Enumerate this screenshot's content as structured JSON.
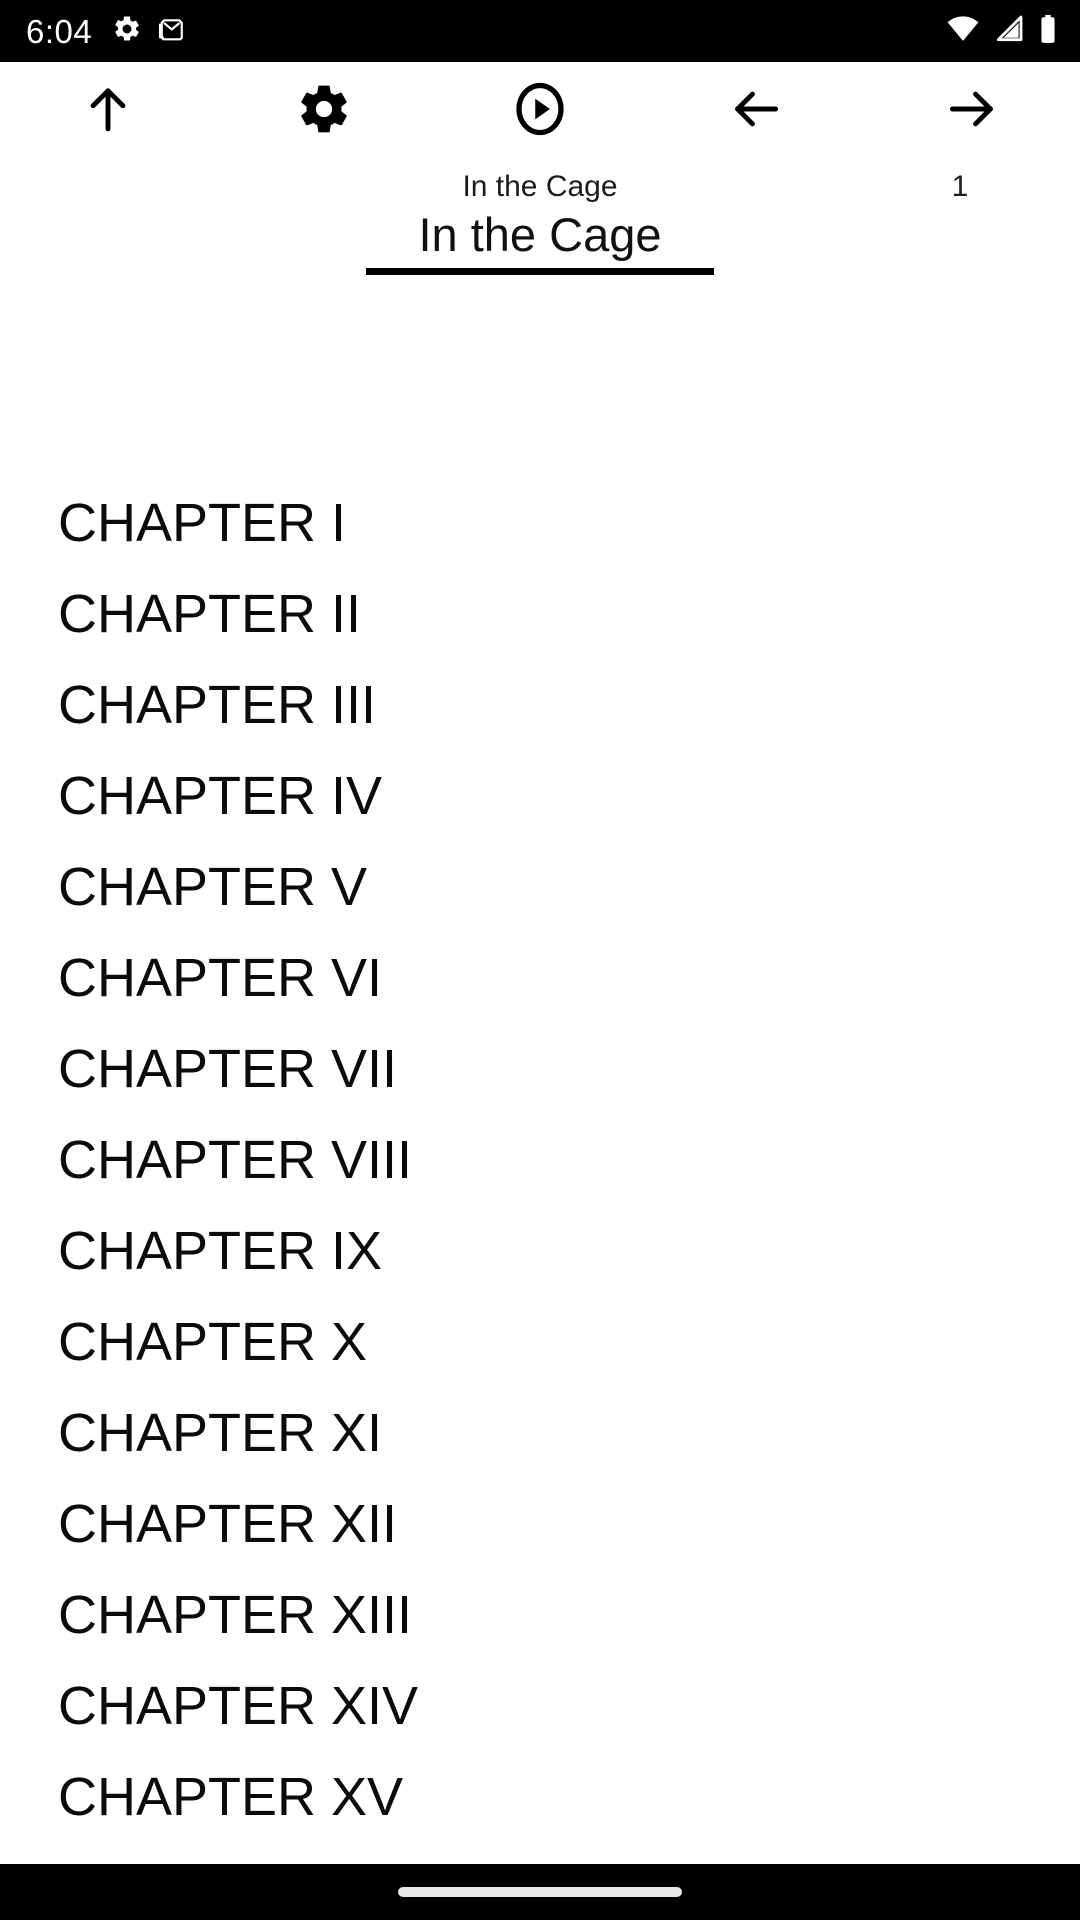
{
  "status_bar": {
    "time": "6:04",
    "left_icons": [
      "settings-gear-icon",
      "gmail-icon"
    ],
    "right_icons": [
      "wifi-icon",
      "cellular-signal-icon",
      "battery-full-icon"
    ],
    "background_color": "#000000",
    "foreground_color": "#ffffff"
  },
  "toolbar": {
    "buttons": [
      {
        "name": "scroll-to-top-button",
        "icon": "arrow-up-icon"
      },
      {
        "name": "settings-button",
        "icon": "gear-icon"
      },
      {
        "name": "play-button",
        "icon": "play-circle-icon"
      },
      {
        "name": "previous-button",
        "icon": "arrow-left-icon"
      },
      {
        "name": "next-button",
        "icon": "arrow-right-icon"
      }
    ]
  },
  "header": {
    "subtitle": "In the Cage",
    "page_number": "1",
    "document_title": "In the Cage"
  },
  "toc": {
    "items": [
      {
        "label": "CHAPTER I"
      },
      {
        "label": "CHAPTER II"
      },
      {
        "label": "CHAPTER III"
      },
      {
        "label": "CHAPTER IV"
      },
      {
        "label": "CHAPTER V"
      },
      {
        "label": "CHAPTER VI"
      },
      {
        "label": "CHAPTER VII"
      },
      {
        "label": "CHAPTER VIII"
      },
      {
        "label": "CHAPTER IX"
      },
      {
        "label": "CHAPTER X"
      },
      {
        "label": "CHAPTER XI"
      },
      {
        "label": "CHAPTER XII"
      },
      {
        "label": "CHAPTER XIII"
      },
      {
        "label": "CHAPTER XIV"
      },
      {
        "label": "CHAPTER XV"
      }
    ]
  },
  "nav_bar": {
    "gesture_pill": "home-gesture-pill",
    "background_color": "#000000"
  },
  "theme": {
    "page_background": "#ffffff",
    "text_color": "#0b0b0b",
    "accent_color": "#000000"
  }
}
